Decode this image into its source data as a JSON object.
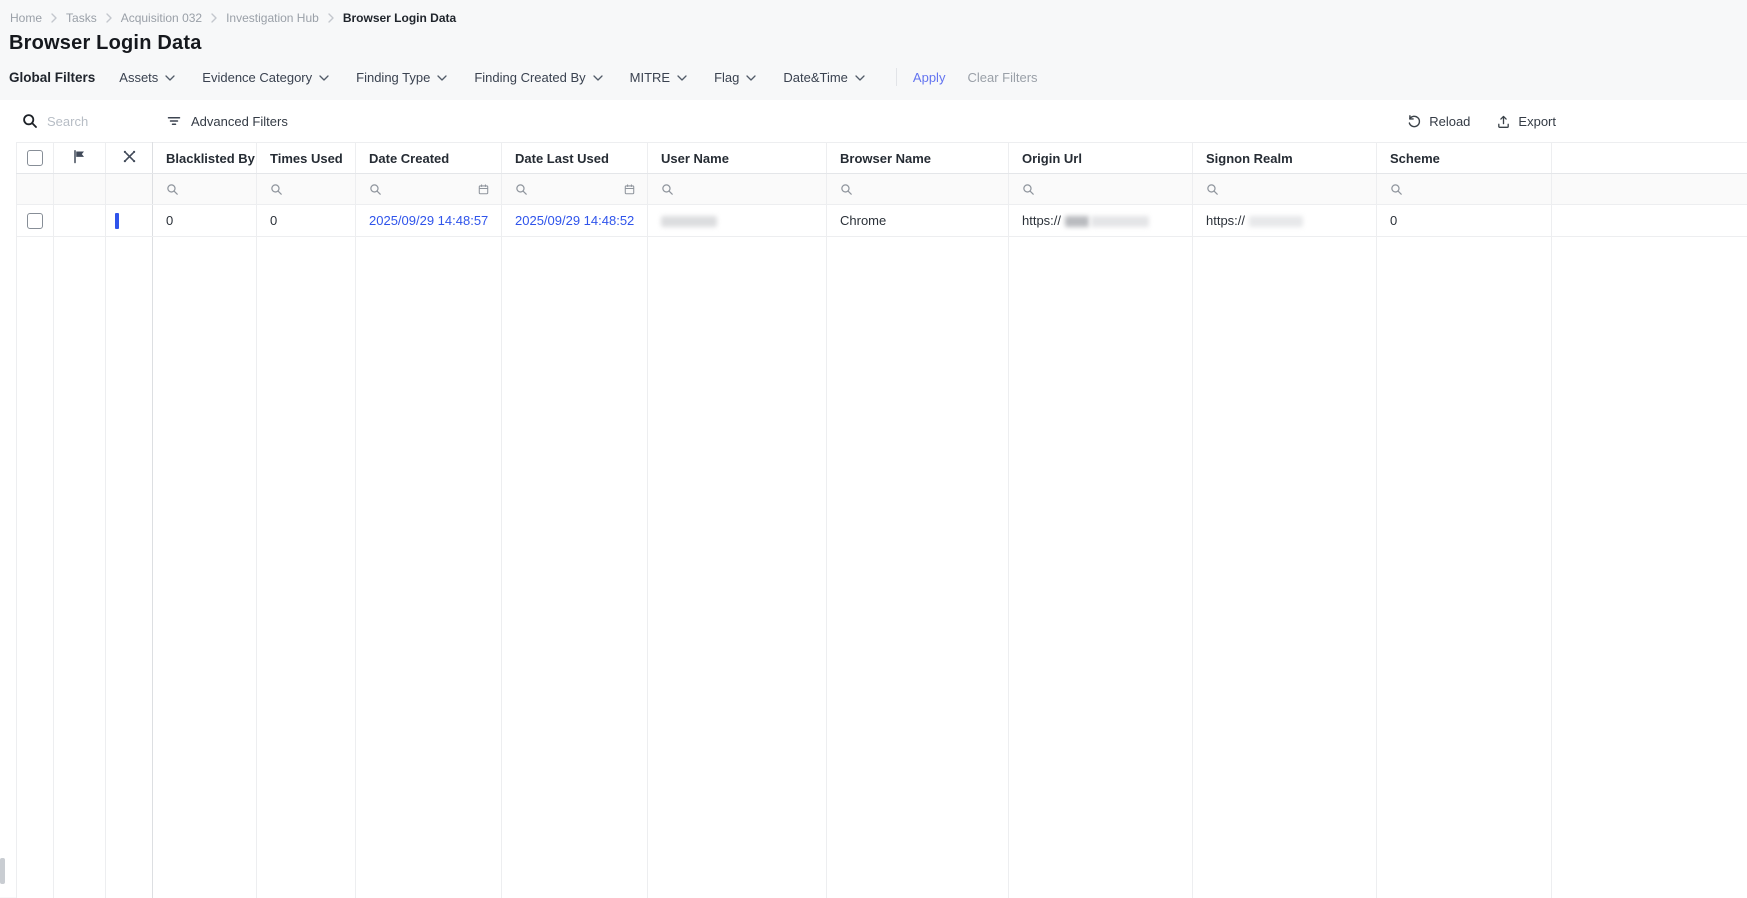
{
  "breadcrumb": {
    "items": [
      "Home",
      "Tasks",
      "Acquisition 032",
      "Investigation Hub",
      "Browser Login Data"
    ]
  },
  "page": {
    "title": "Browser Login Data"
  },
  "filters": {
    "label": "Global Filters",
    "dropdowns": [
      "Assets",
      "Evidence Category",
      "Finding Type",
      "Finding Created By",
      "MITRE",
      "Flag",
      "Date&Time"
    ],
    "apply_label": "Apply",
    "clear_label": "Clear Filters"
  },
  "toolbar": {
    "search_placeholder": "Search",
    "advanced_filters_label": "Advanced Filters",
    "reload_label": "Reload",
    "export_label": "Export"
  },
  "table": {
    "columns": [
      "Blacklisted By ...",
      "Times Used",
      "Date Created",
      "Date Last Used",
      "User Name",
      "Browser Name",
      "Origin Url",
      "Signon Realm",
      "Scheme"
    ],
    "row": {
      "blacklisted_by": "0",
      "times_used": "0",
      "date_created": "2025/09/29 14:48:57",
      "date_last_used": "2025/09/29 14:48:52",
      "user_name": "(redacted)",
      "browser_name": "Chrome",
      "origin_url_prefix": "https://",
      "signon_realm_prefix": "https://",
      "scheme": "0"
    }
  },
  "colors": {
    "accent_blue": "#6374f0",
    "link_blue": "#2f54eb",
    "row_marker_blue": "#2f54eb"
  }
}
